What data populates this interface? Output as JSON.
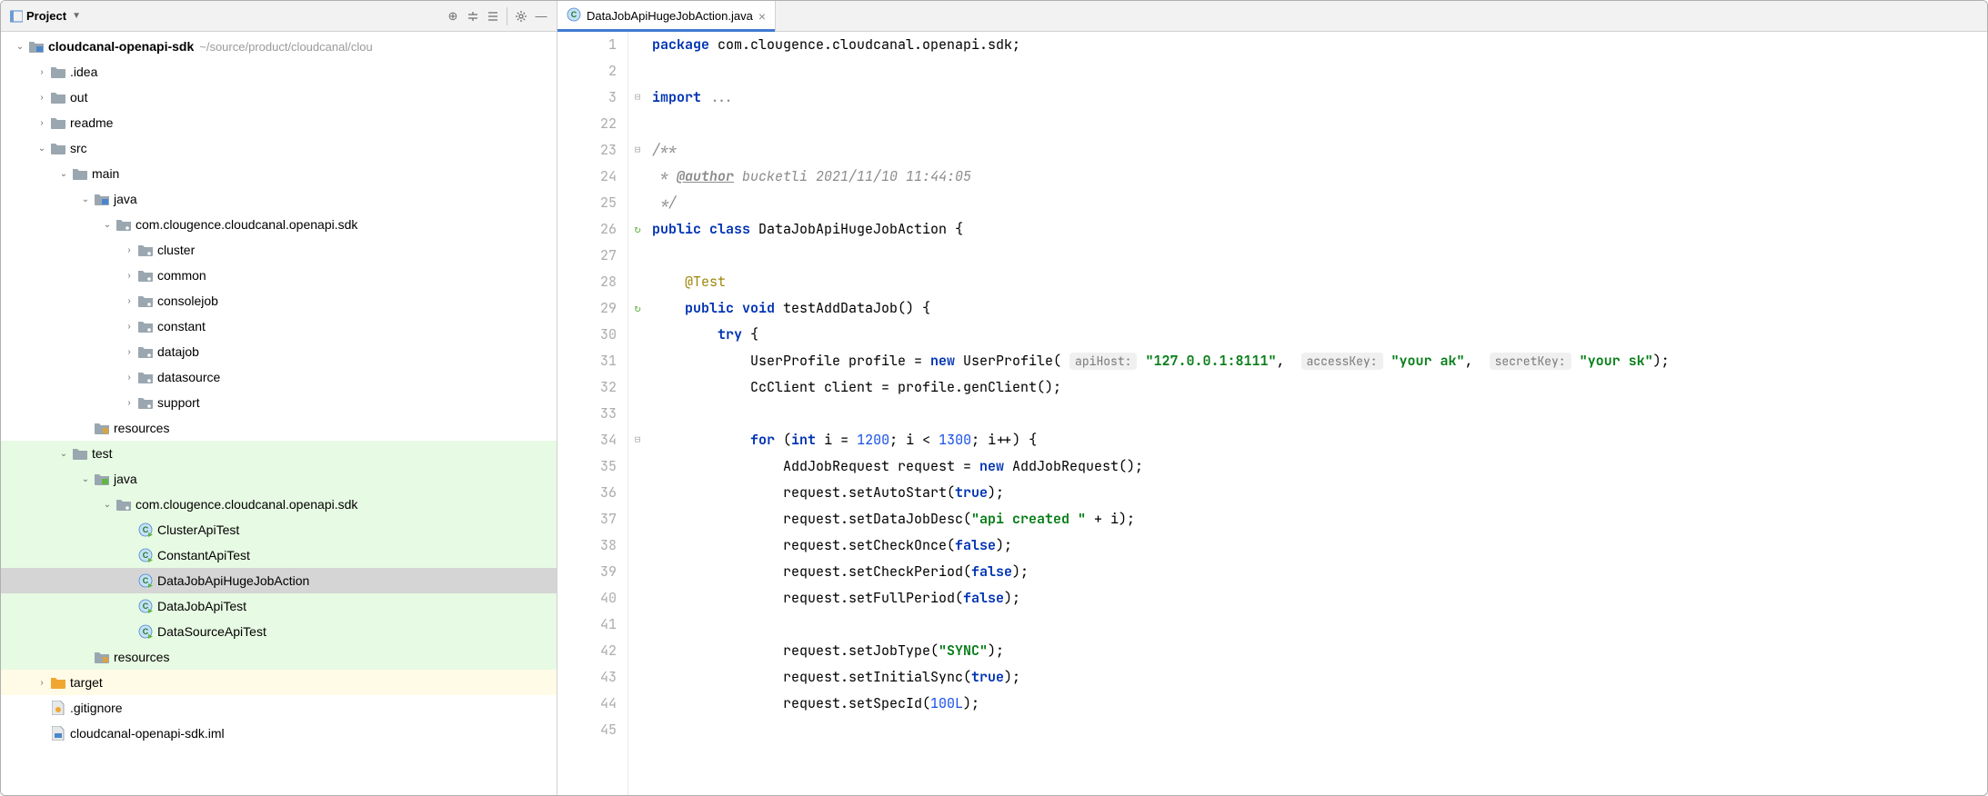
{
  "projectPanel": {
    "title": "Project",
    "toolbarIcons": [
      "target-icon",
      "collapse-icon",
      "expand-icon",
      "gear-icon",
      "minimize-icon"
    ]
  },
  "tree": [
    {
      "indent": 0,
      "twisty": "v",
      "icon": "folder-blue",
      "label": "cloudcanal-openapi-sdk",
      "bold": true,
      "hint": "~/source/product/cloudcanal/clou",
      "row": "root"
    },
    {
      "indent": 1,
      "twisty": ">",
      "icon": "folder",
      "label": ".idea"
    },
    {
      "indent": 1,
      "twisty": ">",
      "icon": "folder",
      "label": "out"
    },
    {
      "indent": 1,
      "twisty": ">",
      "icon": "folder",
      "label": "readme"
    },
    {
      "indent": 1,
      "twisty": "v",
      "icon": "folder",
      "label": "src"
    },
    {
      "indent": 2,
      "twisty": "v",
      "icon": "folder",
      "label": "main"
    },
    {
      "indent": 3,
      "twisty": "v",
      "icon": "folder-blue",
      "label": "java"
    },
    {
      "indent": 4,
      "twisty": "v",
      "icon": "package",
      "label": "com.clougence.cloudcanal.openapi.sdk"
    },
    {
      "indent": 5,
      "twisty": ">",
      "icon": "package",
      "label": "cluster"
    },
    {
      "indent": 5,
      "twisty": ">",
      "icon": "package",
      "label": "common"
    },
    {
      "indent": 5,
      "twisty": ">",
      "icon": "package",
      "label": "consolejob"
    },
    {
      "indent": 5,
      "twisty": ">",
      "icon": "package",
      "label": "constant"
    },
    {
      "indent": 5,
      "twisty": ">",
      "icon": "package",
      "label": "datajob"
    },
    {
      "indent": 5,
      "twisty": ">",
      "icon": "package",
      "label": "datasource"
    },
    {
      "indent": 5,
      "twisty": ">",
      "icon": "package",
      "label": "support"
    },
    {
      "indent": 3,
      "twisty": "",
      "icon": "resource",
      "label": "resources"
    },
    {
      "indent": 2,
      "twisty": "v",
      "icon": "folder",
      "label": "test",
      "hl": "test"
    },
    {
      "indent": 3,
      "twisty": "v",
      "icon": "folder-green",
      "label": "java",
      "hl": "test"
    },
    {
      "indent": 4,
      "twisty": "v",
      "icon": "package",
      "label": "com.clougence.cloudcanal.openapi.sdk",
      "hl": "test"
    },
    {
      "indent": 5,
      "twisty": "",
      "icon": "java-run",
      "label": "ClusterApiTest",
      "hl": "test"
    },
    {
      "indent": 5,
      "twisty": "",
      "icon": "java-run",
      "label": "ConstantApiTest",
      "hl": "test"
    },
    {
      "indent": 5,
      "twisty": "",
      "icon": "java-run",
      "label": "DataJobApiHugeJobAction",
      "hl": "test",
      "selected": true
    },
    {
      "indent": 5,
      "twisty": "",
      "icon": "java-run",
      "label": "DataJobApiTest",
      "hl": "test"
    },
    {
      "indent": 5,
      "twisty": "",
      "icon": "java-run",
      "label": "DataSourceApiTest",
      "hl": "test"
    },
    {
      "indent": 3,
      "twisty": "",
      "icon": "resource",
      "label": "resources",
      "hl": "test"
    },
    {
      "indent": 1,
      "twisty": ">",
      "icon": "folder-orange",
      "label": "target",
      "hl": "target"
    },
    {
      "indent": 1,
      "twisty": "",
      "icon": "file",
      "label": ".gitignore"
    },
    {
      "indent": 1,
      "twisty": "",
      "icon": "iml",
      "label": "cloudcanal-openapi-sdk.iml"
    }
  ],
  "tab": {
    "icon": "java-run",
    "name": "DataJobApiHugeJobAction.java"
  },
  "code": {
    "lineNumbers": [
      1,
      2,
      3,
      22,
      23,
      24,
      25,
      26,
      27,
      28,
      29,
      30,
      31,
      32,
      33,
      34,
      35,
      36,
      37,
      38,
      39,
      40,
      41,
      42,
      43,
      44,
      45
    ],
    "gutterMarks": {
      "0": "",
      "1": "",
      "2": "fold",
      "3": "",
      "4": "fold",
      "5": "",
      "6": "",
      "7": "run",
      "8": "",
      "9": "",
      "10": "run",
      "11": "",
      "12": "",
      "13": "",
      "14": "",
      "15": "fold",
      "16": "",
      "17": "",
      "18": "",
      "19": "",
      "20": "",
      "21": "",
      "22": "",
      "23": "",
      "24": "",
      "25": "",
      "26": ""
    },
    "lines": [
      {
        "t": [
          {
            "c": "kw",
            "s": "package "
          },
          {
            "c": "ident",
            "s": "com.clougence.cloudcanal.openapi.sdk;"
          }
        ]
      },
      {
        "t": []
      },
      {
        "t": [
          {
            "c": "kw",
            "s": "import "
          },
          {
            "c": "fold-dots",
            "s": "..."
          }
        ]
      },
      {
        "t": []
      },
      {
        "t": [
          {
            "c": "cmt",
            "s": "/**"
          }
        ]
      },
      {
        "t": [
          {
            "c": "cmt",
            "s": " * "
          },
          {
            "c": "cmt-tag",
            "s": "@author"
          },
          {
            "c": "cmt",
            "s": " bucketli 2021/11/10 11:44:05"
          }
        ]
      },
      {
        "t": [
          {
            "c": "cmt",
            "s": " */"
          }
        ]
      },
      {
        "t": [
          {
            "c": "kw",
            "s": "public class "
          },
          {
            "c": "ident",
            "s": "DataJobApiHugeJobAction {"
          }
        ]
      },
      {
        "t": []
      },
      {
        "t": [
          {
            "c": "ident",
            "s": "    "
          },
          {
            "c": "ann",
            "s": "@Test"
          }
        ]
      },
      {
        "t": [
          {
            "c": "ident",
            "s": "    "
          },
          {
            "c": "kw",
            "s": "public void "
          },
          {
            "c": "method",
            "s": "testAddDataJob"
          },
          {
            "c": "ident",
            "s": "() {"
          }
        ]
      },
      {
        "t": [
          {
            "c": "ident",
            "s": "        "
          },
          {
            "c": "kw",
            "s": "try "
          },
          {
            "c": "ident",
            "s": "{"
          }
        ]
      },
      {
        "t": [
          {
            "c": "ident",
            "s": "            UserProfile profile = "
          },
          {
            "c": "kw",
            "s": "new "
          },
          {
            "c": "ident",
            "s": "UserProfile( "
          },
          {
            "c": "param-hint",
            "s": "apiHost:"
          },
          {
            "c": "ident",
            "s": " "
          },
          {
            "c": "str",
            "s": "\"127.0.0.1:8111\""
          },
          {
            "c": "ident",
            "s": ",  "
          },
          {
            "c": "param-hint",
            "s": "accessKey:"
          },
          {
            "c": "ident",
            "s": " "
          },
          {
            "c": "str",
            "s": "\"your ak\""
          },
          {
            "c": "ident",
            "s": ",  "
          },
          {
            "c": "param-hint",
            "s": "secretKey:"
          },
          {
            "c": "ident",
            "s": " "
          },
          {
            "c": "str",
            "s": "\"your sk\""
          },
          {
            "c": "ident",
            "s": ");"
          }
        ]
      },
      {
        "t": [
          {
            "c": "ident",
            "s": "            CcClient client = profile.genClient();"
          }
        ]
      },
      {
        "t": []
      },
      {
        "t": [
          {
            "c": "ident",
            "s": "            "
          },
          {
            "c": "kw",
            "s": "for "
          },
          {
            "c": "ident",
            "s": "("
          },
          {
            "c": "kw",
            "s": "int "
          },
          {
            "c": "ident",
            "s": "i = "
          },
          {
            "c": "num",
            "s": "1200"
          },
          {
            "c": "ident",
            "s": "; i < "
          },
          {
            "c": "num",
            "s": "1300"
          },
          {
            "c": "ident",
            "s": "; i++) {"
          }
        ]
      },
      {
        "t": [
          {
            "c": "ident",
            "s": "                AddJobRequest request = "
          },
          {
            "c": "kw",
            "s": "new "
          },
          {
            "c": "ident",
            "s": "AddJobRequest();"
          }
        ]
      },
      {
        "t": [
          {
            "c": "ident",
            "s": "                request.setAutoStart("
          },
          {
            "c": "bool",
            "s": "true"
          },
          {
            "c": "ident",
            "s": ");"
          }
        ]
      },
      {
        "t": [
          {
            "c": "ident",
            "s": "                request.setDataJobDesc("
          },
          {
            "c": "str",
            "s": "\"api created \""
          },
          {
            "c": "ident",
            "s": " + i);"
          }
        ]
      },
      {
        "t": [
          {
            "c": "ident",
            "s": "                request.setCheckOnce("
          },
          {
            "c": "bool",
            "s": "false"
          },
          {
            "c": "ident",
            "s": ");"
          }
        ]
      },
      {
        "t": [
          {
            "c": "ident",
            "s": "                request.setCheckPeriod("
          },
          {
            "c": "bool",
            "s": "false"
          },
          {
            "c": "ident",
            "s": ");"
          }
        ]
      },
      {
        "t": [
          {
            "c": "ident",
            "s": "                request.setFullPeriod("
          },
          {
            "c": "bool",
            "s": "false"
          },
          {
            "c": "ident",
            "s": ");"
          }
        ]
      },
      {
        "t": []
      },
      {
        "t": [
          {
            "c": "ident",
            "s": "                request.setJobType("
          },
          {
            "c": "str",
            "s": "\"SYNC\""
          },
          {
            "c": "ident",
            "s": ");"
          }
        ]
      },
      {
        "t": [
          {
            "c": "ident",
            "s": "                request.setInitialSync("
          },
          {
            "c": "bool",
            "s": "true"
          },
          {
            "c": "ident",
            "s": ");"
          }
        ]
      },
      {
        "t": [
          {
            "c": "ident",
            "s": "                request.setSpecId("
          },
          {
            "c": "num",
            "s": "100L"
          },
          {
            "c": "ident",
            "s": ");"
          }
        ]
      },
      {
        "t": []
      }
    ]
  }
}
